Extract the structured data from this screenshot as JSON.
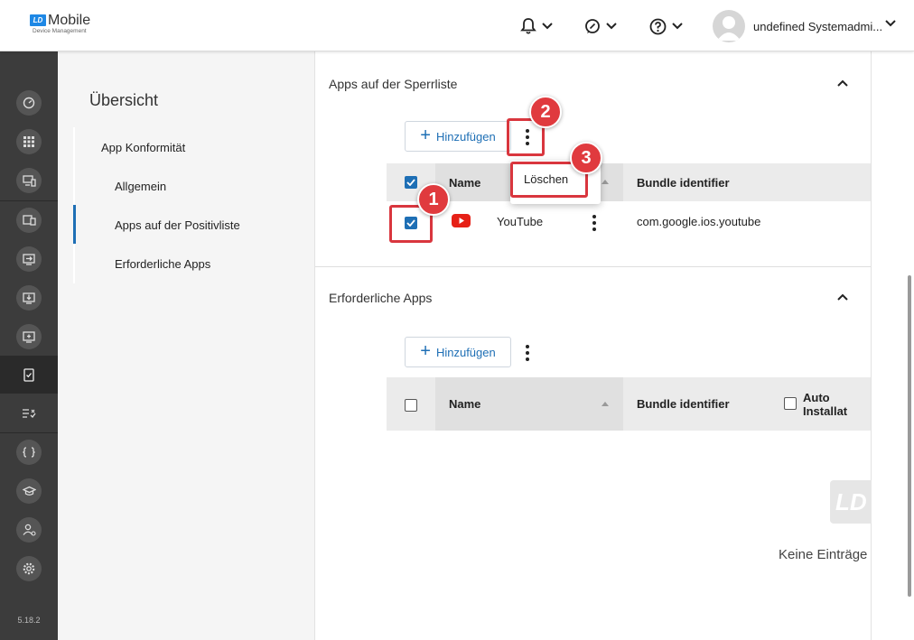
{
  "app": {
    "logo_badge": "LD",
    "logo_title": "Mobile",
    "logo_subtitle": "Device Management",
    "version": "5.18.2"
  },
  "header": {
    "user_name": "undefined Systemadmi...",
    "icons": [
      "bell-icon",
      "chat-icon",
      "help-icon"
    ]
  },
  "sidebar": {
    "icons": [
      "dashboard-icon",
      "grid-icon",
      "devices-icon",
      "device-groups-icon",
      "import-icon",
      "download-icon",
      "screen-icon",
      "compliance-icon",
      "checklist-icon",
      "code-icon",
      "graduation-icon",
      "users-icon",
      "settings-icon"
    ]
  },
  "nav": {
    "title": "Übersicht",
    "items": [
      {
        "label": "App Konformität"
      },
      {
        "label": "Allgemein"
      },
      {
        "label": "Apps auf der Positivliste"
      },
      {
        "label": "Erforderliche Apps"
      }
    ]
  },
  "blacklist": {
    "title": "Apps auf der Sperrliste",
    "add_label": "Hinzufügen",
    "columns": {
      "name": "Name",
      "bundle": "Bundle identifier"
    },
    "rows": [
      {
        "name": "YouTube",
        "bundle": "com.google.ios.youtube",
        "checked": true
      }
    ],
    "menu_item": "Löschen"
  },
  "required": {
    "title": "Erforderliche Apps",
    "add_label": "Hinzufügen",
    "columns": {
      "name": "Name",
      "bundle": "Bundle identifier",
      "auto_install": "Auto Installat"
    },
    "empty_logo": "LD",
    "empty_text": "Keine Einträge g"
  },
  "annotations": [
    "1",
    "2",
    "3"
  ],
  "colors": {
    "accent": "#1e6fb5",
    "sidebar": "#3c3c3c",
    "annotation": "#e03a3e",
    "youtube": "#e62117"
  }
}
